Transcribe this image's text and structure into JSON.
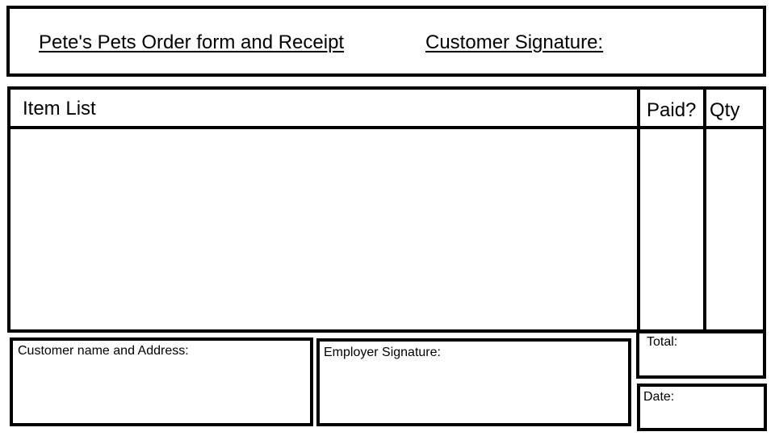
{
  "header": {
    "title": "Pete's Pets Order form and Receipt",
    "customer_signature_label": "Customer Signature:"
  },
  "items_table": {
    "columns": [
      "Item List",
      "Paid?",
      "Qty"
    ]
  },
  "footer": {
    "customer_name_address_label": "Customer name and Address:",
    "employer_signature_label": "Employer Signature:",
    "total_label": "Total:",
    "date_label": "Date:"
  }
}
